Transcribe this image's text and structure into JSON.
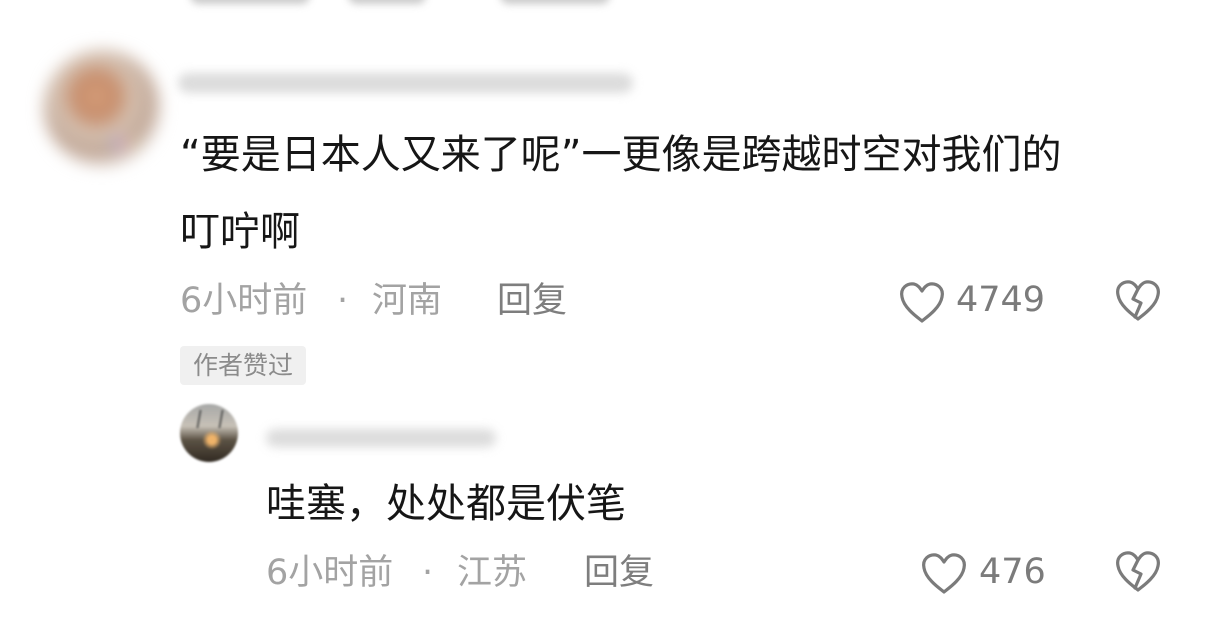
{
  "comments": [
    {
      "text_lines": [
        "“要是日本人又来了呢”一更像是跨越时空对我们的",
        "叮咛啊"
      ],
      "time": "6小时前",
      "separator": "·",
      "location": "河南",
      "reply_label": "回复",
      "likes": "4749",
      "badge": "作者赞过"
    }
  ],
  "replies": [
    {
      "text": "哇塞，处处都是伏笔",
      "time": "6小时前",
      "separator": "·",
      "location": "江苏",
      "reply_label": "回复",
      "likes": "476"
    }
  ],
  "icons": {
    "like": "heart-outline",
    "dislike": "broken-heart-outline"
  },
  "colors": {
    "text": "#161616",
    "meta": "#a3a3a3",
    "count": "#7b7b7b",
    "badge_bg": "#f0f0f0"
  }
}
